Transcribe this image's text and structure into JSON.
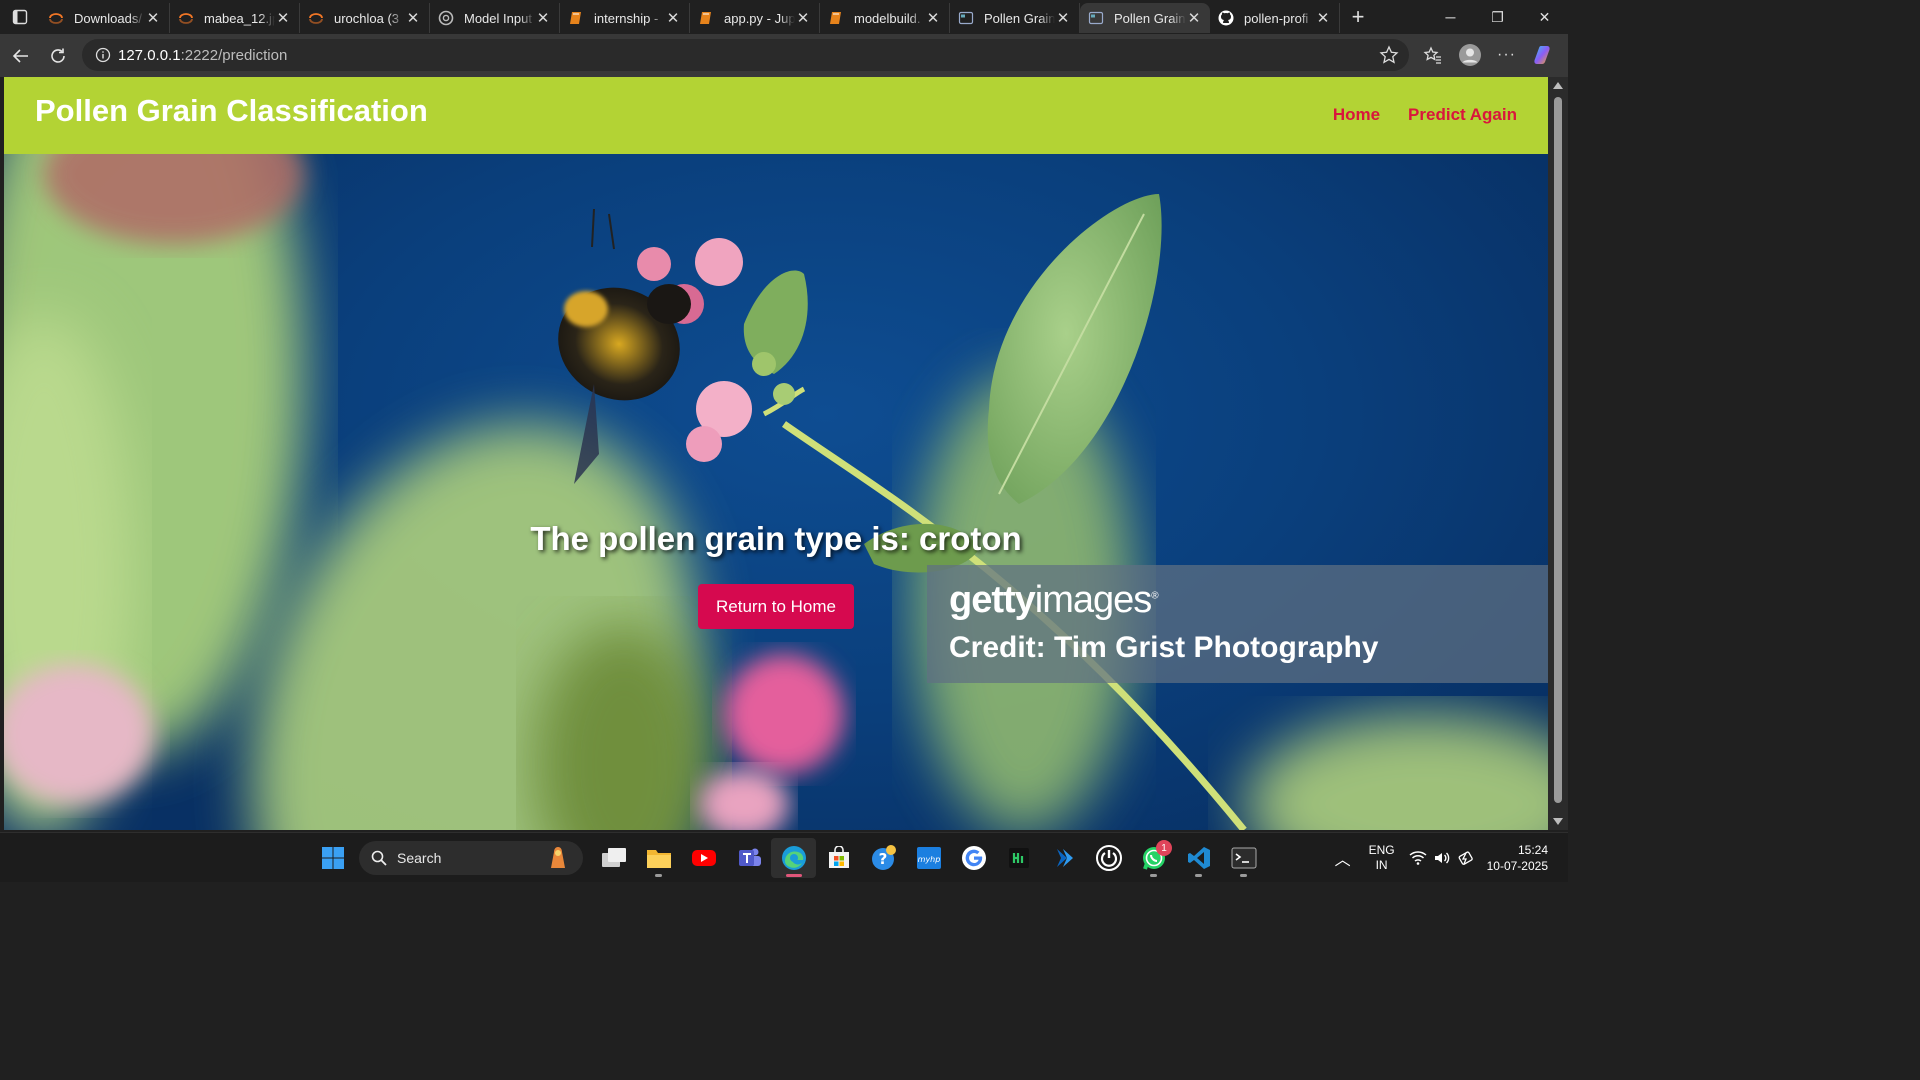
{
  "browser": {
    "tabs": [
      {
        "title": "Downloads/",
        "icon": "jupyter-icon",
        "active": false
      },
      {
        "title": "mabea_12.jp",
        "icon": "jupyter-icon",
        "active": false
      },
      {
        "title": "urochloa (3",
        "icon": "jupyter-icon",
        "active": false
      },
      {
        "title": "Model Input",
        "icon": "openai-icon",
        "active": false
      },
      {
        "title": "internship -",
        "icon": "book-icon",
        "active": false
      },
      {
        "title": "app.py - Jup",
        "icon": "book-icon",
        "active": false
      },
      {
        "title": "modelbuild.",
        "icon": "book-icon",
        "active": false
      },
      {
        "title": "Pollen Grain",
        "icon": "page-icon",
        "active": false
      },
      {
        "title": "Pollen Grain",
        "icon": "page-icon",
        "active": true
      },
      {
        "title": "pollen-profi",
        "icon": "github-icon",
        "active": false
      }
    ],
    "url_host": "127.0.0.1",
    "url_rest": ":2222/prediction"
  },
  "page": {
    "brand": "Pollen Grain Classification",
    "nav_home": "Home",
    "nav_predict_again": "Predict Again",
    "result_text": "The pollen grain type is: croton",
    "return_button": "Return to Home",
    "watermark_logo_bold": "getty",
    "watermark_logo_light": "images",
    "watermark_credit": "Credit: Tim Grist Photography",
    "colors": {
      "navbar": "#b3d334",
      "nav_link": "#d9163c",
      "button": "#d6094f",
      "sky": "#0a3f7c"
    }
  },
  "taskbar": {
    "search_placeholder": "Search",
    "whatsapp_badge": "1",
    "lang_top": "ENG",
    "lang_bottom": "IN",
    "time": "15:24",
    "date": "10-07-2025"
  }
}
